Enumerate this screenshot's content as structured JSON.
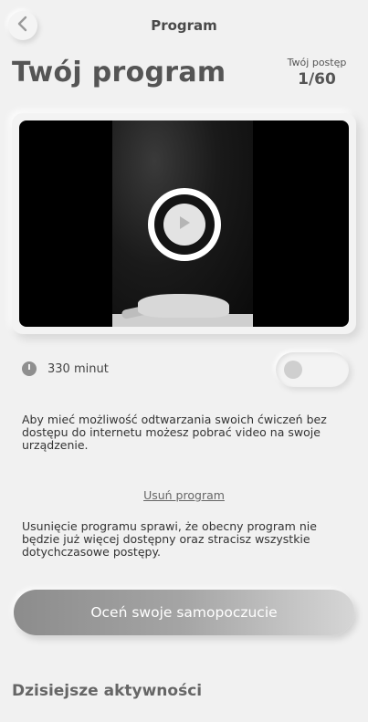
{
  "header": {
    "title": "Program",
    "back_icon": "chevron-left-icon"
  },
  "page": {
    "title": "Twój program",
    "progress_label": "Twój postęp",
    "progress_value": "1/60"
  },
  "video": {
    "play_icon": "play-icon"
  },
  "duration": {
    "icon": "clock-icon",
    "text": "330 minut"
  },
  "offline_toggle": {
    "enabled": false
  },
  "info": {
    "offline_text": "Aby mieć możliwość odtwarzania swoich ćwiczeń bez dostępu do internetu możesz pobrać video na swoje urządzenie."
  },
  "remove": {
    "link_label": "Usuń program",
    "warning_text": "Usunięcie programu sprawi, że obecny program nie będzie już więcej dostępny oraz stracisz wszystkie dotychczasowe postępy."
  },
  "rate_button": {
    "label": "Oceń swoje samopoczucie"
  },
  "activities": {
    "title": "Dzisiejsze aktywności"
  },
  "colors": {
    "background": "#f1f1f1",
    "button_gradient_start": "#8c8c8c",
    "button_gradient_end": "#d6d6d6",
    "text": "#3a3a3a"
  }
}
